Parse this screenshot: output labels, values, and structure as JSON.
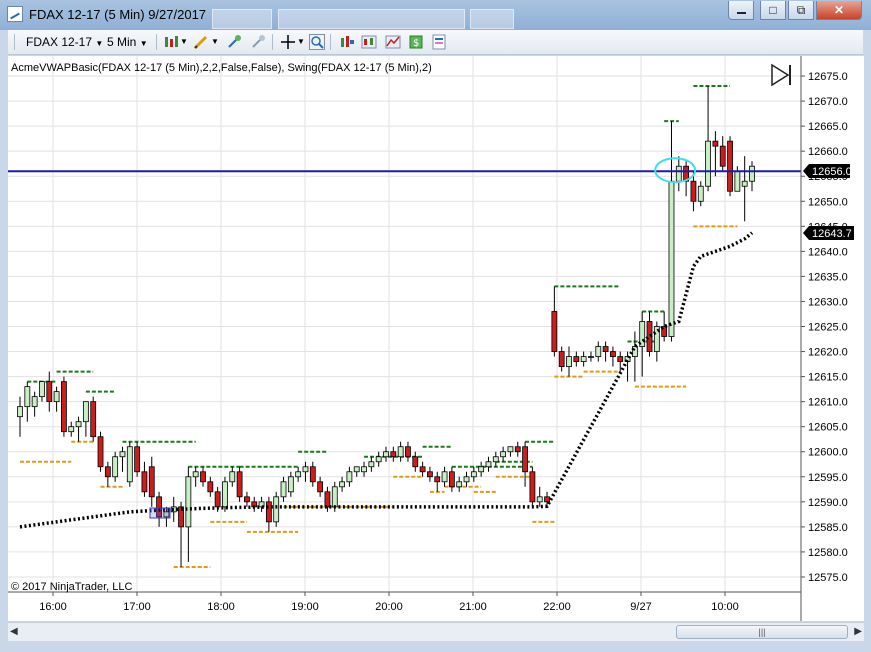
{
  "window": {
    "title": "FDAX 12-17 (5 Min)  9/27/2017",
    "minimize_label": "",
    "maximize_label": "□",
    "restore_label": "⧉",
    "close_label": "✕"
  },
  "toolbar": {
    "instrument": "FDAX 12-17",
    "interval": "5 Min",
    "icons": [
      "bar-style-icon",
      "pencil-icon",
      "pointer-add-icon",
      "pointer-remove-icon",
      "crosshair-icon",
      "zoom-icon",
      "indicators-icon",
      "strategy-icon",
      "chart-trader-icon",
      "properties-icon",
      "data-box-icon"
    ]
  },
  "chart": {
    "indicator_label": "AcmeVWAPBasic(FDAX 12-17 (5 Min),2,2,False,False), Swing(FDAX 12-17 (5 Min),2)",
    "copyright": "© 2017 NinjaTrader, LLC",
    "last_price_label": "12656.0",
    "vwap_price_label": "12643.7",
    "y_ticks": [
      "12675.0",
      "12670.0",
      "12665.0",
      "12660.0",
      "12655.0",
      "12650.0",
      "12645.0",
      "12640.0",
      "12635.0",
      "12630.0",
      "12625.0",
      "12620.0",
      "12615.0",
      "12610.0",
      "12605.0",
      "12600.0",
      "12595.0",
      "12590.0",
      "12585.0",
      "12580.0",
      "12575.0"
    ],
    "x_ticks": [
      "16:00",
      "17:00",
      "18:00",
      "19:00",
      "20:00",
      "21:00",
      "22:00",
      "9/27",
      "10:00"
    ],
    "colors": {
      "up": "#c8eec6",
      "down": "#c81e1e",
      "horizontal_line": "#1a1ab4",
      "swing_high": "#1a7a1a",
      "swing_low": "#e09a16",
      "vwap": "#000000",
      "highlight": "#3ee0ea"
    }
  },
  "chart_data": {
    "type": "candlestick",
    "ylim": [
      12572,
      12679
    ],
    "horizontal_line": 12656.0,
    "candles": [
      {
        "o": 12607,
        "h": 12611,
        "l": 12603,
        "c": 12609
      },
      {
        "o": 12609,
        "h": 12614,
        "l": 12606,
        "c": 12613
      },
      {
        "o": 12609,
        "h": 12612,
        "l": 12607,
        "c": 12611
      },
      {
        "o": 12611,
        "h": 12614,
        "l": 12610,
        "c": 12614
      },
      {
        "o": 12614,
        "h": 12616,
        "l": 12608,
        "c": 12610
      },
      {
        "o": 12610,
        "h": 12613,
        "l": 12608,
        "c": 12612
      },
      {
        "o": 12614,
        "h": 12615,
        "l": 12603,
        "c": 12604
      },
      {
        "o": 12604,
        "h": 12606,
        "l": 12603,
        "c": 12605
      },
      {
        "o": 12605,
        "h": 12607,
        "l": 12602,
        "c": 12606
      },
      {
        "o": 12606,
        "h": 12610,
        "l": 12603,
        "c": 12610
      },
      {
        "o": 12610,
        "h": 12611,
        "l": 12602,
        "c": 12603
      },
      {
        "o": 12603,
        "h": 12604,
        "l": 12596,
        "c": 12597
      },
      {
        "o": 12597,
        "h": 12598,
        "l": 12593,
        "c": 12595
      },
      {
        "o": 12595,
        "h": 12600,
        "l": 12594,
        "c": 12599
      },
      {
        "o": 12599,
        "h": 12601,
        "l": 12596,
        "c": 12600
      },
      {
        "o": 12594,
        "h": 12602,
        "l": 12593,
        "c": 12601
      },
      {
        "o": 12601,
        "h": 12602,
        "l": 12595,
        "c": 12596
      },
      {
        "o": 12596,
        "h": 12598,
        "l": 12591,
        "c": 12592
      },
      {
        "o": 12597,
        "h": 12599,
        "l": 12589,
        "c": 12591
      },
      {
        "o": 12591,
        "h": 12592,
        "l": 12585,
        "c": 12587
      },
      {
        "o": 12587,
        "h": 12589,
        "l": 12585,
        "c": 12588
      },
      {
        "o": 12588,
        "h": 12591,
        "l": 12586,
        "c": 12589
      },
      {
        "o": 12589,
        "h": 12590,
        "l": 12577,
        "c": 12585
      },
      {
        "o": 12585,
        "h": 12597,
        "l": 12578,
        "c": 12595
      },
      {
        "o": 12595,
        "h": 12597,
        "l": 12593,
        "c": 12596
      },
      {
        "o": 12596,
        "h": 12597,
        "l": 12593,
        "c": 12594
      },
      {
        "o": 12594,
        "h": 12595,
        "l": 12591,
        "c": 12592
      },
      {
        "o": 12592,
        "h": 12593,
        "l": 12588,
        "c": 12589
      },
      {
        "o": 12589,
        "h": 12595,
        "l": 12588,
        "c": 12594
      },
      {
        "o": 12594,
        "h": 12597,
        "l": 12593,
        "c": 12596
      },
      {
        "o": 12596,
        "h": 12597,
        "l": 12590,
        "c": 12591
      },
      {
        "o": 12591,
        "h": 12592,
        "l": 12589,
        "c": 12590
      },
      {
        "o": 12590,
        "h": 12591,
        "l": 12588,
        "c": 12589
      },
      {
        "o": 12589,
        "h": 12591,
        "l": 12588,
        "c": 12590
      },
      {
        "o": 12590,
        "h": 12591,
        "l": 12584,
        "c": 12586
      },
      {
        "o": 12586,
        "h": 12592,
        "l": 12585,
        "c": 12591
      },
      {
        "o": 12591,
        "h": 12595,
        "l": 12590,
        "c": 12594
      },
      {
        "o": 12592,
        "h": 12596,
        "l": 12591,
        "c": 12595
      },
      {
        "o": 12595,
        "h": 12597,
        "l": 12594,
        "c": 12596
      },
      {
        "o": 12596,
        "h": 12598,
        "l": 12594,
        "c": 12597
      },
      {
        "o": 12597,
        "h": 12598,
        "l": 12593,
        "c": 12594
      },
      {
        "o": 12594,
        "h": 12595,
        "l": 12591,
        "c": 12592
      },
      {
        "o": 12592,
        "h": 12593,
        "l": 12588,
        "c": 12589
      },
      {
        "o": 12589,
        "h": 12594,
        "l": 12588,
        "c": 12593
      },
      {
        "o": 12593,
        "h": 12595,
        "l": 12592,
        "c": 12594
      },
      {
        "o": 12594,
        "h": 12597,
        "l": 12593,
        "c": 12596
      },
      {
        "o": 12596,
        "h": 12597,
        "l": 12595,
        "c": 12597
      },
      {
        "o": 12596,
        "h": 12598,
        "l": 12595,
        "c": 12597
      },
      {
        "o": 12597,
        "h": 12599,
        "l": 12596,
        "c": 12598
      },
      {
        "o": 12598,
        "h": 12600,
        "l": 12597,
        "c": 12599
      },
      {
        "o": 12599,
        "h": 12601,
        "l": 12598,
        "c": 12600
      },
      {
        "o": 12600,
        "h": 12601,
        "l": 12598,
        "c": 12599
      },
      {
        "o": 12599,
        "h": 12602,
        "l": 12598,
        "c": 12601
      },
      {
        "o": 12601,
        "h": 12602,
        "l": 12598,
        "c": 12599
      },
      {
        "o": 12599,
        "h": 12600,
        "l": 12596,
        "c": 12597
      },
      {
        "o": 12597,
        "h": 12598,
        "l": 12595,
        "c": 12596
      },
      {
        "o": 12596,
        "h": 12597,
        "l": 12594,
        "c": 12595
      },
      {
        "o": 12595,
        "h": 12596,
        "l": 12592,
        "c": 12594
      },
      {
        "o": 12594,
        "h": 12597,
        "l": 12593,
        "c": 12596
      },
      {
        "o": 12596,
        "h": 12597,
        "l": 12592,
        "c": 12593
      },
      {
        "o": 12593,
        "h": 12595,
        "l": 12592,
        "c": 12594
      },
      {
        "o": 12594,
        "h": 12596,
        "l": 12593,
        "c": 12595
      },
      {
        "o": 12595,
        "h": 12597,
        "l": 12594,
        "c": 12596
      },
      {
        "o": 12596,
        "h": 12598,
        "l": 12595,
        "c": 12597
      },
      {
        "o": 12597,
        "h": 12599,
        "l": 12596,
        "c": 12598
      },
      {
        "o": 12598,
        "h": 12600,
        "l": 12597,
        "c": 12599
      },
      {
        "o": 12599,
        "h": 12601,
        "l": 12598,
        "c": 12600
      },
      {
        "o": 12600,
        "h": 12601,
        "l": 12599,
        "c": 12601
      },
      {
        "o": 12601,
        "h": 12602,
        "l": 12599,
        "c": 12600
      },
      {
        "o": 12601,
        "h": 12602,
        "l": 12593,
        "c": 12596
      },
      {
        "o": 12596,
        "h": 12597,
        "l": 12589,
        "c": 12590
      },
      {
        "o": 12590,
        "h": 12593,
        "l": 12589,
        "c": 12591
      },
      {
        "o": 12591,
        "h": 12592,
        "l": 12589,
        "c": 12590
      },
      {
        "o": 12628,
        "h": 12633,
        "l": 12619,
        "c": 12620
      },
      {
        "o": 12620,
        "h": 12621,
        "l": 12616,
        "c": 12617
      },
      {
        "o": 12617,
        "h": 12621,
        "l": 12615,
        "c": 12619
      },
      {
        "o": 12619,
        "h": 12620,
        "l": 12617,
        "c": 12618
      },
      {
        "o": 12618,
        "h": 12620,
        "l": 12617,
        "c": 12619
      },
      {
        "o": 12619,
        "h": 12620,
        "l": 12618,
        "c": 12619
      },
      {
        "o": 12619,
        "h": 12622,
        "l": 12618,
        "c": 12621
      },
      {
        "o": 12621,
        "h": 12622,
        "l": 12618,
        "c": 12620
      },
      {
        "o": 12620,
        "h": 12621,
        "l": 12617,
        "c": 12619
      },
      {
        "o": 12619,
        "h": 12620,
        "l": 12616,
        "c": 12618
      },
      {
        "o": 12618,
        "h": 12620,
        "l": 12614,
        "c": 12619
      },
      {
        "o": 12619,
        "h": 12624,
        "l": 12614,
        "c": 12621
      },
      {
        "o": 12621,
        "h": 12628,
        "l": 12615,
        "c": 12626
      },
      {
        "o": 12626,
        "h": 12628,
        "l": 12619,
        "c": 12620
      },
      {
        "o": 12620,
        "h": 12626,
        "l": 12618,
        "c": 12625
      },
      {
        "o": 12625,
        "h": 12628,
        "l": 12622,
        "c": 12623
      },
      {
        "o": 12623,
        "h": 12666,
        "l": 12622,
        "c": 12654
      },
      {
        "o": 12654,
        "h": 12659,
        "l": 12652,
        "c": 12657
      },
      {
        "o": 12657,
        "h": 12658,
        "l": 12651,
        "c": 12654
      },
      {
        "o": 12654,
        "h": 12656,
        "l": 12648,
        "c": 12650
      },
      {
        "o": 12650,
        "h": 12654,
        "l": 12649,
        "c": 12653
      },
      {
        "o": 12653,
        "h": 12673,
        "l": 12652,
        "c": 12662
      },
      {
        "o": 12662,
        "h": 12664,
        "l": 12655,
        "c": 12661
      },
      {
        "o": 12661,
        "h": 12663,
        "l": 12656,
        "c": 12657
      },
      {
        "o": 12662,
        "h": 12663,
        "l": 12651,
        "c": 12652
      },
      {
        "o": 12652,
        "h": 12657,
        "l": 12652,
        "c": 12656
      },
      {
        "o": 12653,
        "h": 12659,
        "l": 12646,
        "c": 12654
      },
      {
        "o": 12654,
        "h": 12658,
        "l": 12652,
        "c": 12657
      }
    ],
    "swing_highs": [
      {
        "from": 1,
        "to": 5,
        "price": 12614
      },
      {
        "from": 5,
        "to": 10,
        "price": 12616
      },
      {
        "from": 9,
        "to": 13,
        "price": 12612
      },
      {
        "from": 14,
        "to": 24,
        "price": 12602
      },
      {
        "from": 23,
        "to": 30,
        "price": 12597
      },
      {
        "from": 30,
        "to": 38,
        "price": 12597
      },
      {
        "from": 38,
        "to": 42,
        "price": 12600
      },
      {
        "from": 47,
        "to": 55,
        "price": 12599
      },
      {
        "from": 55,
        "to": 59,
        "price": 12601
      },
      {
        "from": 59,
        "to": 70,
        "price": 12597
      },
      {
        "from": 65,
        "to": 70,
        "price": 12598
      },
      {
        "from": 69,
        "to": 73,
        "price": 12602
      },
      {
        "from": 73,
        "to": 82,
        "price": 12633
      },
      {
        "from": 83,
        "to": 87,
        "price": 12622
      },
      {
        "from": 85,
        "to": 88,
        "price": 12628
      },
      {
        "from": 88,
        "to": 90,
        "price": 12666
      },
      {
        "from": 92,
        "to": 97,
        "price": 12673
      }
    ],
    "swing_lows": [
      {
        "from": 0,
        "to": 7,
        "price": 12598
      },
      {
        "from": 7,
        "to": 10,
        "price": 12602
      },
      {
        "from": 11,
        "to": 14,
        "price": 12593
      },
      {
        "from": 21,
        "to": 26,
        "price": 12577
      },
      {
        "from": 26,
        "to": 31,
        "price": 12586
      },
      {
        "from": 31,
        "to": 38,
        "price": 12584
      },
      {
        "from": 36,
        "to": 51,
        "price": 12589
      },
      {
        "from": 51,
        "to": 55,
        "price": 12595
      },
      {
        "from": 56,
        "to": 58,
        "price": 12592
      },
      {
        "from": 58,
        "to": 63,
        "price": 12593
      },
      {
        "from": 62,
        "to": 65,
        "price": 12592
      },
      {
        "from": 65,
        "to": 70,
        "price": 12595
      },
      {
        "from": 70,
        "to": 73,
        "price": 12586
      },
      {
        "from": 73,
        "to": 77,
        "price": 12615
      },
      {
        "from": 77,
        "to": 82,
        "price": 12616
      },
      {
        "from": 84,
        "to": 91,
        "price": 12613
      },
      {
        "from": 92,
        "to": 98,
        "price": 12645
      }
    ],
    "vwap": [
      [
        0,
        12585
      ],
      [
        5,
        12586
      ],
      [
        10,
        12587
      ],
      [
        15,
        12588
      ],
      [
        20,
        12588.4
      ],
      [
        25,
        12588.7
      ],
      [
        30,
        12588.9
      ],
      [
        35,
        12589
      ],
      [
        40,
        12589
      ],
      [
        45,
        12589
      ],
      [
        50,
        12589
      ],
      [
        55,
        12589
      ],
      [
        60,
        12589
      ],
      [
        65,
        12589
      ],
      [
        70,
        12589
      ],
      [
        72,
        12589.1
      ],
      [
        84,
        12621
      ],
      [
        86,
        12623
      ],
      [
        88,
        12625
      ],
      [
        90,
        12626
      ],
      [
        92,
        12637
      ],
      [
        93,
        12639
      ],
      [
        95,
        12640
      ],
      [
        97,
        12641
      ],
      [
        99,
        12642.5
      ],
      [
        100,
        12643.7
      ]
    ]
  }
}
